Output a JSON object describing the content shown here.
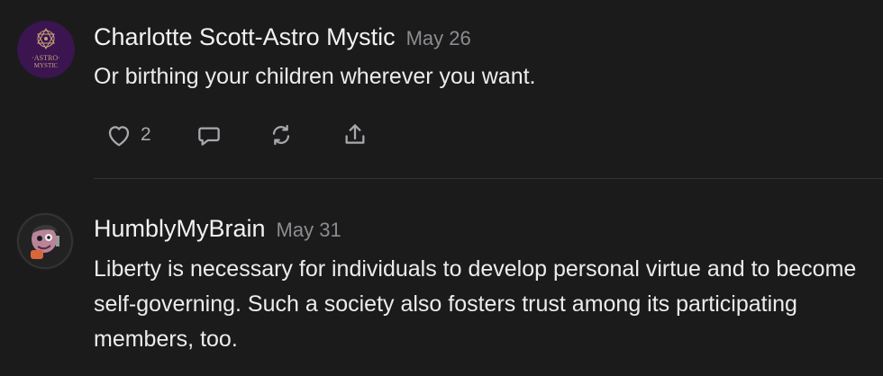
{
  "comments": [
    {
      "author": "Charlotte Scott-Astro Mystic",
      "date": "May 26",
      "text": "Or birthing your children wherever you want.",
      "avatar": {
        "icon": "astro-mystic-logo",
        "text_line1": "·ASTRO·",
        "text_line2": "MYSTIC",
        "bg_color": "#3a1550"
      },
      "actions": {
        "like_count": "2",
        "icons": [
          "heart-icon",
          "comment-icon",
          "restack-icon",
          "share-icon"
        ]
      }
    },
    {
      "author": "HumblyMyBrain",
      "date": "May 31",
      "text": "Liberty is necessary for individuals to develop personal virtue and to become self-governing. Such a society also fosters trust among its participating members, too.",
      "avatar": {
        "icon": "cartoon-character-avatar",
        "bg_color": "#222222"
      }
    }
  ],
  "colors": {
    "background": "#1b1b1c",
    "name": "#f2f2f2",
    "date": "#8c8c90",
    "body": "#ececec",
    "icon": "#a9a9ad",
    "divider": "#343436"
  }
}
